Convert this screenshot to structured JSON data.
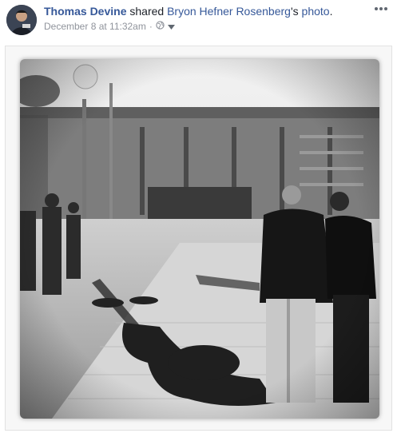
{
  "post": {
    "author": "Thomas Devine",
    "action": "shared",
    "shared_from": "Bryon Hefner Rosenberg",
    "possessive": "'s",
    "object": "photo",
    "period": ".",
    "timestamp": "December 8 at 11:32am",
    "separator": "·"
  },
  "icons": {
    "privacy": "globe-icon",
    "audience_menu": "chevron-down-icon",
    "more": "more-options-icon"
  },
  "colors": {
    "link": "#365899",
    "text": "#1d2129",
    "meta": "#90949c"
  }
}
